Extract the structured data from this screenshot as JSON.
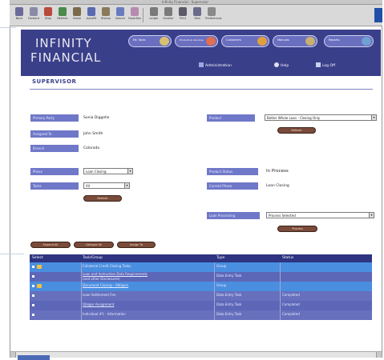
{
  "browser": {
    "title": "Infinity Financial - Supervisor",
    "toolbar": [
      {
        "label": "Back",
        "icon": "back-arrow-icon",
        "color": "#6a6a9a"
      },
      {
        "label": "Forward",
        "icon": "forward-arrow-icon",
        "color": "#8a8aa8"
      },
      {
        "label": "Stop",
        "icon": "stop-icon",
        "color": "#b84a3a"
      },
      {
        "label": "Refresh",
        "icon": "refresh-icon",
        "color": "#4a8a4a"
      },
      {
        "label": "Home",
        "icon": "home-icon",
        "color": "#7a6a4a"
      },
      {
        "label": "AutoFill",
        "icon": "autofill-icon",
        "color": "#5a6ab0"
      },
      {
        "label": "History",
        "icon": "history-icon",
        "color": "#8a7a5a"
      },
      {
        "label": "Search",
        "icon": "search-icon",
        "color": "#6a7ac0"
      },
      {
        "label": "Favorites",
        "icon": "favorites-icon",
        "color": "#b88ab0"
      },
      {
        "label": "Larger",
        "icon": "larger-text-icon",
        "color": "#7a7a7a"
      },
      {
        "label": "Smaller",
        "icon": "smaller-text-icon",
        "color": "#7a7a7a"
      },
      {
        "label": "Print",
        "icon": "print-icon",
        "color": "#5a5a6a"
      },
      {
        "label": "Mail",
        "icon": "mail-icon",
        "color": "#6a6a8a"
      },
      {
        "label": "Preferences",
        "icon": "preferences-icon",
        "color": "#8a8a8a"
      }
    ]
  },
  "header": {
    "logo_line1": "INFINITY",
    "logo_line2": "FINANCIAL",
    "tabs": [
      {
        "label": "My Tasks",
        "icon_color": "#d8c070"
      },
      {
        "label": "Products & Services",
        "icon_color": "#e07050"
      },
      {
        "label": "Customers",
        "icon_color": "#e0a040"
      },
      {
        "label": "Manuals",
        "icon_color": "#c8b070"
      },
      {
        "label": "Reports",
        "icon_color": "#70a0d0"
      }
    ],
    "subnav": [
      {
        "label": "Administration",
        "icon": "administration-icon"
      },
      {
        "label": "Help",
        "icon": "help-icon"
      },
      {
        "label": "Log Off",
        "icon": "log-off-icon"
      }
    ]
  },
  "page": {
    "title": "SUPERVISOR"
  },
  "form": {
    "primary_party_label": "Primary Party",
    "primary_party_value": "Sonia Diggelle",
    "assigned_to_label": "Assigned To",
    "assigned_to_value": "John Smith",
    "branch_label": "Branch",
    "branch_value": "Colorado",
    "product_label": "Product",
    "product_value": "Better Whole Loan - Closing Only",
    "product_button": "Refresh",
    "phase_label": "Phase",
    "phase_value": "Loan Closing",
    "tasks_label": "Tasks",
    "tasks_value": "All",
    "filter_button": "Refresh",
    "product_status_label": "Product Status",
    "product_status_value": "In Process",
    "current_phase_label": "Current Phase",
    "current_phase_value": "Loan Closing",
    "loan_processing_label": "Loan Processing",
    "loan_processing_value": "Process Selected",
    "process_button": "Process"
  },
  "actions": {
    "expand_all": "Expand All",
    "collapse_all": "Collapse All",
    "assign_to": "Assign To"
  },
  "table": {
    "columns": [
      "Select",
      "Task/Group",
      "Type",
      "Status"
    ],
    "rows": [
      {
        "task": "Collateral Credit Closing Tasks",
        "type": "Group",
        "status": "",
        "folder": true,
        "link": false,
        "bg": "#4a8ee0"
      },
      {
        "task": "Loan and Instruction Data Requirements",
        "task2": "(and other Disclosures)",
        "type": "Data Entry Task",
        "status": "",
        "folder": false,
        "link": true,
        "bg": "#5d67b8"
      },
      {
        "task": "Document Closing - Obligors",
        "type": "Group",
        "status": "",
        "folder": true,
        "link": true,
        "bg": "#4a8ee0"
      },
      {
        "task": "Loan Settlement Fee",
        "type": "Data Entry Task",
        "status": "Completed",
        "folder": false,
        "link": false,
        "bg": "#6670bd"
      },
      {
        "task": "Obligor Assignment",
        "type": "Data Entry Task",
        "status": "Completed",
        "folder": false,
        "link": true,
        "bg": "#5d67b8"
      },
      {
        "task": "Individual #1 - Information",
        "type": "Data Entry Task",
        "status": "Completed",
        "folder": false,
        "link": false,
        "bg": "#6670bd"
      }
    ]
  }
}
